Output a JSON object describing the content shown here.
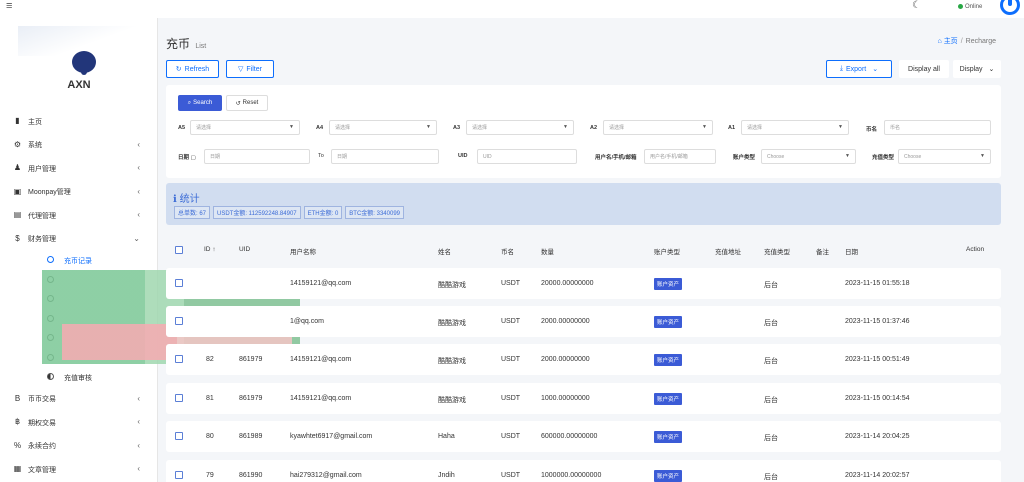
{
  "topbar": {
    "online_label": "Online"
  },
  "brand": {
    "name": "AXN"
  },
  "sidebar": {
    "items": [
      {
        "label": "主页",
        "icon": "bar-chart-icon",
        "chev": false
      },
      {
        "label": "系统",
        "icon": "gear-icon",
        "chev": true
      },
      {
        "label": "用户管理",
        "icon": "users-icon",
        "chev": true
      },
      {
        "label": "Moonpay管理",
        "icon": "id-card-icon",
        "chev": true
      },
      {
        "label": "代理管理",
        "icon": "id-badge-icon",
        "chev": true
      },
      {
        "label": "财务管理",
        "icon": "dollar-icon",
        "chev": true
      }
    ],
    "sub_items": [
      {
        "label": "充币记录",
        "active": true
      },
      {
        "label": "",
        "active": false
      },
      {
        "label": "",
        "active": false
      },
      {
        "label": "",
        "active": false
      },
      {
        "label": "",
        "active": false
      },
      {
        "label": "",
        "active": false
      },
      {
        "label": "充值审核",
        "active": false
      }
    ],
    "items_after": [
      {
        "label": "币币交易",
        "icon": "bitcoin-icon",
        "chev": true
      },
      {
        "label": "期权交易",
        "icon": "bitcoin-b-icon",
        "chev": true
      },
      {
        "label": "永续合约",
        "icon": "percent-icon",
        "chev": true
      },
      {
        "label": "文章管理",
        "icon": "newspaper-icon",
        "chev": true
      }
    ]
  },
  "page": {
    "title": "充币",
    "subtitle": "List",
    "breadcrumb_home": "主页",
    "breadcrumb_sep": "/",
    "breadcrumb_current": "Recharge"
  },
  "toolbar": {
    "refresh": "Refresh",
    "filter": "Filter",
    "export": "Export",
    "display_all": "Display all",
    "display": "Display"
  },
  "filters": {
    "search": "Search",
    "reset": "Reset",
    "row1": [
      {
        "label": "A5",
        "placeholder": "请选择"
      },
      {
        "label": "A4",
        "placeholder": "请选择"
      },
      {
        "label": "A3",
        "placeholder": "请选择"
      },
      {
        "label": "A2",
        "placeholder": "请选择"
      },
      {
        "label": "A1",
        "placeholder": "请选择"
      },
      {
        "label": "币名",
        "placeholder": "币名"
      }
    ],
    "date_label": "日期",
    "date_from": "日期",
    "date_to_sep": "To",
    "date_to": "日期",
    "uid_label": "UID",
    "uid_placeholder": "UID",
    "user_label": "用户名/手机/邮箱",
    "user_placeholder": "用户名/手机/邮箱",
    "account_type_label": "账户类型",
    "account_type_placeholder": "Choose",
    "recharge_type_label": "充值类型",
    "recharge_type_placeholder": "Choose"
  },
  "stats": {
    "title": "统计",
    "chips": [
      "总单数: 67",
      "USDT金额: 112592248.84907",
      "ETH金额: 0",
      "BTC金额: 3340099"
    ]
  },
  "table": {
    "headers": {
      "id": "ID",
      "uid": "UID",
      "username": "用户名称",
      "name": "姓名",
      "coin": "币名",
      "amount": "数量",
      "account_type": "账户类型",
      "address": "充值地址",
      "recharge_type": "充值类型",
      "remark": "备注",
      "date": "日期",
      "action": "Action"
    },
    "rows": [
      {
        "id": "",
        "uid": "",
        "username": "14159121@qq.com",
        "name": "酷酷游戏",
        "coin": "USDT",
        "amount": "20000.00000000",
        "account_type": "账户资产",
        "recharge_type": "后台",
        "date": "2023-11-15 01:55:18"
      },
      {
        "id": "",
        "uid": "",
        "username": "1@qq.com",
        "name": "酷酷游戏",
        "coin": "USDT",
        "amount": "2000.00000000",
        "account_type": "账户资产",
        "recharge_type": "后台",
        "date": "2023-11-15 01:37:46"
      },
      {
        "id": "82",
        "uid": "861979",
        "username": "14159121@qq.com",
        "name": "酷酷游戏",
        "coin": "USDT",
        "amount": "2000.00000000",
        "account_type": "账户资产",
        "recharge_type": "后台",
        "date": "2023-11-15 00:51:49"
      },
      {
        "id": "81",
        "uid": "861979",
        "username": "14159121@qq.com",
        "name": "酷酷游戏",
        "coin": "USDT",
        "amount": "1000.00000000",
        "account_type": "账户资产",
        "recharge_type": "后台",
        "date": "2023-11-15 00:14:54"
      },
      {
        "id": "80",
        "uid": "861989",
        "username": "kyawhtet6917@gmail.com",
        "name": "Haha",
        "coin": "USDT",
        "amount": "600000.00000000",
        "account_type": "账户资产",
        "recharge_type": "后台",
        "date": "2023-11-14 20:04:25"
      },
      {
        "id": "79",
        "uid": "861990",
        "username": "hai279312@gmail.com",
        "name": "Jndih",
        "coin": "USDT",
        "amount": "1000000.00000000",
        "account_type": "账户资产",
        "recharge_type": "后台",
        "date": "2023-11-14 20:02:57"
      }
    ]
  }
}
